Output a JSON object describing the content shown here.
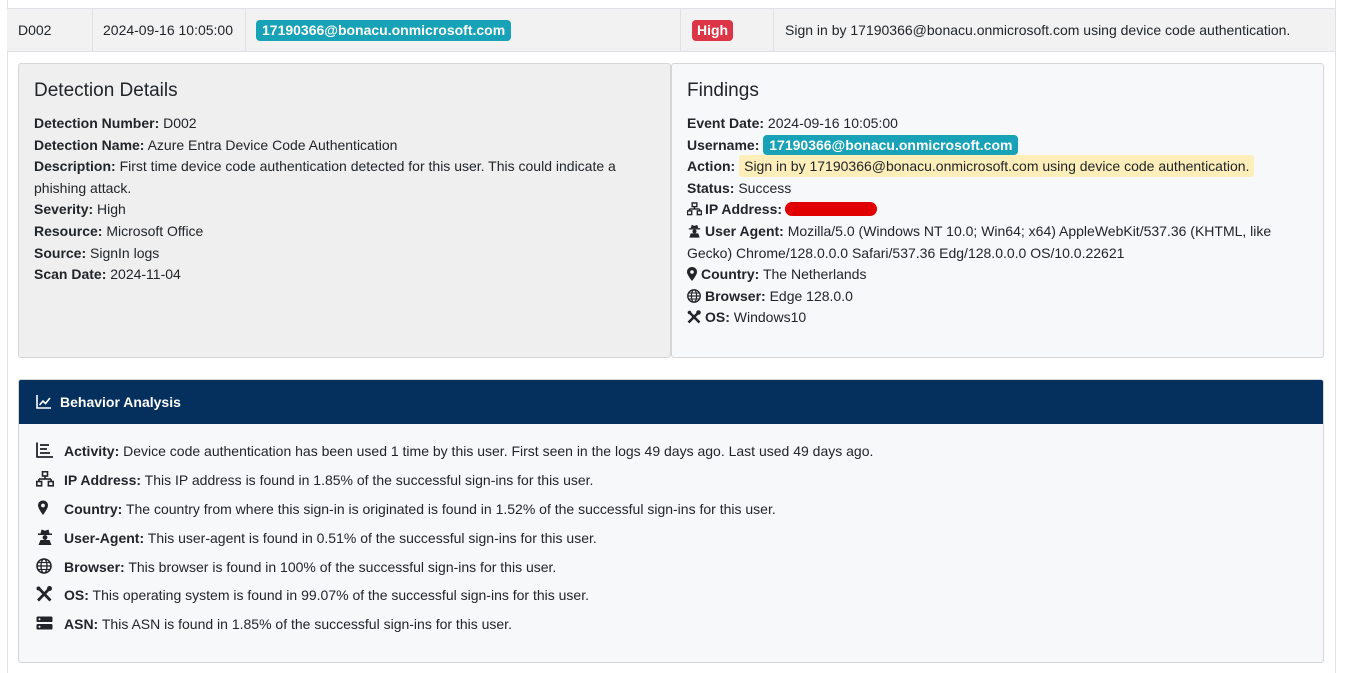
{
  "row": {
    "id": "D002",
    "datetime": "2024-09-16 10:05:00",
    "username": "17190366@bonacu.onmicrosoft.com",
    "severity": "High",
    "description": "Sign in by 17190366@bonacu.onmicrosoft.com using device code authentication."
  },
  "detection": {
    "title": "Detection Details",
    "number_label": "Detection Number:",
    "number": "D002",
    "name_label": "Detection Name:",
    "name": "Azure Entra Device Code Authentication",
    "description_label": "Description:",
    "description": "First time device code authentication detected for this user. This could indicate a phishing attack.",
    "severity_label": "Severity:",
    "severity": "High",
    "resource_label": "Resource:",
    "resource": "Microsoft Office",
    "source_label": "Source:",
    "source": "SignIn logs",
    "scan_date_label": "Scan Date:",
    "scan_date": "2024-11-04"
  },
  "findings": {
    "title": "Findings",
    "event_date_label": "Event Date:",
    "event_date": "2024-09-16 10:05:00",
    "username_label": "Username:",
    "username": "17190366@bonacu.onmicrosoft.com",
    "action_label": "Action:",
    "action": "Sign in by 17190366@bonacu.onmicrosoft.com using device code authentication.",
    "status_label": "Status:",
    "status": "Success",
    "ip_label": "IP Address:",
    "user_agent_label": "User Agent:",
    "user_agent": "Mozilla/5.0 (Windows NT 10.0; Win64; x64) AppleWebKit/537.36 (KHTML, like Gecko) Chrome/128.0.0.0 Safari/537.36 Edg/128.0.0.0 OS/10.0.22621",
    "country_label": "Country:",
    "country": "The Netherlands",
    "browser_label": "Browser:",
    "browser": "Edge 128.0.0",
    "os_label": "OS:",
    "os": "Windows10"
  },
  "behavior": {
    "title": "Behavior Analysis",
    "items": [
      {
        "icon": "list-icon",
        "label": "Activity:",
        "text": "Device code authentication has been used 1 time by this user. First seen in the logs 49 days ago. Last used 49 days ago."
      },
      {
        "icon": "network-icon",
        "label": "IP Address:",
        "text": "This IP address is found in 1.85% of the successful sign-ins for this user."
      },
      {
        "icon": "location-pin-icon",
        "label": "Country:",
        "text": "The country from where this sign-in is originated is found in 1.52% of the successful sign-ins for this user."
      },
      {
        "icon": "user-secret-icon",
        "label": "User-Agent:",
        "text": "This user-agent is found in 0.51% of the successful sign-ins for this user."
      },
      {
        "icon": "globe-icon",
        "label": "Browser:",
        "text": "This browser is found in 100% of the successful sign-ins for this user."
      },
      {
        "icon": "tools-icon",
        "label": "OS:",
        "text": "This operating system is found in 99.07% of the successful sign-ins for this user."
      },
      {
        "icon": "server-icon",
        "label": "ASN:",
        "text": "This ASN is found in 1.85% of the successful sign-ins for this user."
      }
    ]
  },
  "colors": {
    "badge_user": "#17a2b8",
    "badge_high": "#dc3545",
    "header_navy": "#05305e",
    "action_highlight": "#fdeeba",
    "redaction": "#e00000"
  }
}
